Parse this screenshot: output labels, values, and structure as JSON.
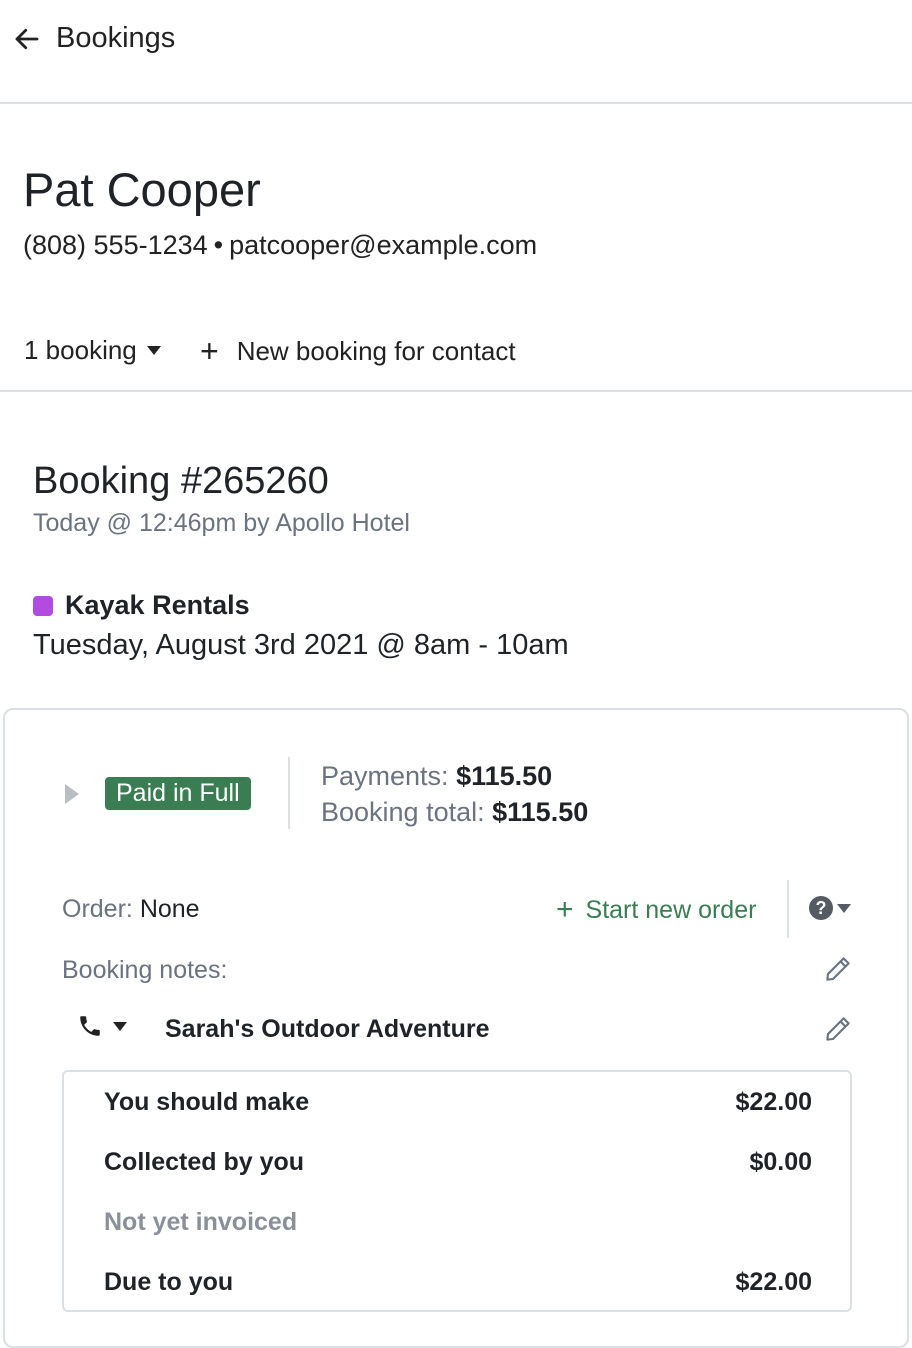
{
  "nav": {
    "back_label": "Bookings"
  },
  "contact": {
    "name": "Pat Cooper",
    "phone": "(808) 555-1234",
    "separator": "•",
    "email": "patcooper@example.com"
  },
  "actions": {
    "bookings_count": "1 booking",
    "new_booking_label": "New booking for contact"
  },
  "booking": {
    "title": "Booking #265260",
    "subtitle": "Today @ 12:46pm by Apollo Hotel",
    "activity": {
      "name": "Kayak Rentals",
      "color": "#b44be1",
      "datetime": "Tuesday, August 3rd 2021 @ 8am - 10am"
    }
  },
  "payment": {
    "status": "Paid in Full",
    "payments_label": "Payments:",
    "payments_value": "$115.50",
    "total_label": "Booking total:",
    "total_value": "$115.50"
  },
  "order": {
    "label": "Order:",
    "value": "None",
    "start_label": "Start new order"
  },
  "notes": {
    "label": "Booking notes:"
  },
  "agent": {
    "name": "Sarah's Outdoor Adventure"
  },
  "summary": {
    "rows": [
      {
        "label": "You should make",
        "value": "$22.00"
      },
      {
        "label": "Collected by you",
        "value": "$0.00"
      },
      {
        "label": "Not yet invoiced",
        "value": ""
      },
      {
        "label": "Due to you",
        "value": "$22.00"
      }
    ]
  },
  "colors": {
    "accent_green": "#3a7d52",
    "muted": "#6b7280",
    "border": "#dcdfe3"
  }
}
